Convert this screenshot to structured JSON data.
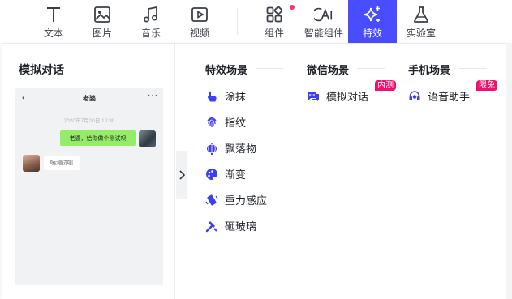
{
  "toolbar": {
    "items": [
      {
        "label": "文本",
        "icon": "text-icon"
      },
      {
        "label": "图片",
        "icon": "image-icon"
      },
      {
        "label": "音乐",
        "icon": "music-icon"
      },
      {
        "label": "视频",
        "icon": "video-icon"
      },
      {
        "label": "组件",
        "icon": "components-icon",
        "has_dot": true
      },
      {
        "label": "智能组件",
        "icon": "ai-icon"
      },
      {
        "label": "特效",
        "icon": "sparkle-icon",
        "active": true
      },
      {
        "label": "实验室",
        "icon": "flask-icon"
      }
    ],
    "accent": "#4a4dff",
    "dot_color": "#ff2f6d"
  },
  "left": {
    "title": "模拟对话",
    "preview": {
      "chat_title": "老婆",
      "back": "‹",
      "more": "···",
      "timestamp": "2020年7月20日 10:30",
      "outgoing_message": "老婆，给你做个测试呗",
      "incoming_message": "咦测试呗"
    }
  },
  "sections": [
    {
      "title": "特效场景",
      "items": [
        {
          "label": "涂抹",
          "icon": "finger-tap-icon"
        },
        {
          "label": "指纹",
          "icon": "fingerprint-icon"
        },
        {
          "label": "飘落物",
          "icon": "lantern-icon"
        },
        {
          "label": "渐变",
          "icon": "palette-icon"
        },
        {
          "label": "重力感应",
          "icon": "tilt-phone-icon"
        },
        {
          "label": "砸玻璃",
          "icon": "hammer-icon"
        }
      ]
    },
    {
      "title": "微信场景",
      "items": [
        {
          "label": "模拟对话",
          "icon": "chat-icon",
          "badge": "内测"
        }
      ]
    },
    {
      "title": "手机场景",
      "items": [
        {
          "label": "语音助手",
          "icon": "headset-icon",
          "badge": "限免"
        }
      ]
    }
  ],
  "colors": {
    "icon_blue": "#3b3ff5",
    "badge_pink": "#f2106b"
  }
}
